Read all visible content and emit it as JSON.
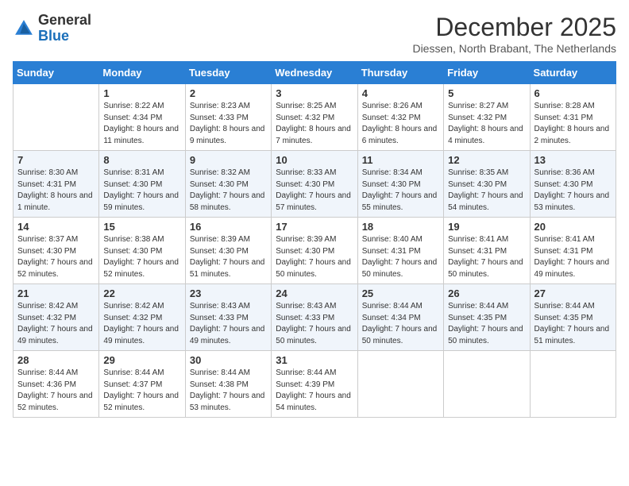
{
  "logo": {
    "general": "General",
    "blue": "Blue"
  },
  "header": {
    "month": "December 2025",
    "location": "Diessen, North Brabant, The Netherlands"
  },
  "weekdays": [
    "Sunday",
    "Monday",
    "Tuesday",
    "Wednesday",
    "Thursday",
    "Friday",
    "Saturday"
  ],
  "weeks": [
    [
      {
        "day": "",
        "sunrise": "",
        "sunset": "",
        "daylight": ""
      },
      {
        "day": "1",
        "sunrise": "Sunrise: 8:22 AM",
        "sunset": "Sunset: 4:34 PM",
        "daylight": "Daylight: 8 hours and 11 minutes."
      },
      {
        "day": "2",
        "sunrise": "Sunrise: 8:23 AM",
        "sunset": "Sunset: 4:33 PM",
        "daylight": "Daylight: 8 hours and 9 minutes."
      },
      {
        "day": "3",
        "sunrise": "Sunrise: 8:25 AM",
        "sunset": "Sunset: 4:32 PM",
        "daylight": "Daylight: 8 hours and 7 minutes."
      },
      {
        "day": "4",
        "sunrise": "Sunrise: 8:26 AM",
        "sunset": "Sunset: 4:32 PM",
        "daylight": "Daylight: 8 hours and 6 minutes."
      },
      {
        "day": "5",
        "sunrise": "Sunrise: 8:27 AM",
        "sunset": "Sunset: 4:32 PM",
        "daylight": "Daylight: 8 hours and 4 minutes."
      },
      {
        "day": "6",
        "sunrise": "Sunrise: 8:28 AM",
        "sunset": "Sunset: 4:31 PM",
        "daylight": "Daylight: 8 hours and 2 minutes."
      }
    ],
    [
      {
        "day": "7",
        "sunrise": "Sunrise: 8:30 AM",
        "sunset": "Sunset: 4:31 PM",
        "daylight": "Daylight: 8 hours and 1 minute."
      },
      {
        "day": "8",
        "sunrise": "Sunrise: 8:31 AM",
        "sunset": "Sunset: 4:30 PM",
        "daylight": "Daylight: 7 hours and 59 minutes."
      },
      {
        "day": "9",
        "sunrise": "Sunrise: 8:32 AM",
        "sunset": "Sunset: 4:30 PM",
        "daylight": "Daylight: 7 hours and 58 minutes."
      },
      {
        "day": "10",
        "sunrise": "Sunrise: 8:33 AM",
        "sunset": "Sunset: 4:30 PM",
        "daylight": "Daylight: 7 hours and 57 minutes."
      },
      {
        "day": "11",
        "sunrise": "Sunrise: 8:34 AM",
        "sunset": "Sunset: 4:30 PM",
        "daylight": "Daylight: 7 hours and 55 minutes."
      },
      {
        "day": "12",
        "sunrise": "Sunrise: 8:35 AM",
        "sunset": "Sunset: 4:30 PM",
        "daylight": "Daylight: 7 hours and 54 minutes."
      },
      {
        "day": "13",
        "sunrise": "Sunrise: 8:36 AM",
        "sunset": "Sunset: 4:30 PM",
        "daylight": "Daylight: 7 hours and 53 minutes."
      }
    ],
    [
      {
        "day": "14",
        "sunrise": "Sunrise: 8:37 AM",
        "sunset": "Sunset: 4:30 PM",
        "daylight": "Daylight: 7 hours and 52 minutes."
      },
      {
        "day": "15",
        "sunrise": "Sunrise: 8:38 AM",
        "sunset": "Sunset: 4:30 PM",
        "daylight": "Daylight: 7 hours and 52 minutes."
      },
      {
        "day": "16",
        "sunrise": "Sunrise: 8:39 AM",
        "sunset": "Sunset: 4:30 PM",
        "daylight": "Daylight: 7 hours and 51 minutes."
      },
      {
        "day": "17",
        "sunrise": "Sunrise: 8:39 AM",
        "sunset": "Sunset: 4:30 PM",
        "daylight": "Daylight: 7 hours and 50 minutes."
      },
      {
        "day": "18",
        "sunrise": "Sunrise: 8:40 AM",
        "sunset": "Sunset: 4:31 PM",
        "daylight": "Daylight: 7 hours and 50 minutes."
      },
      {
        "day": "19",
        "sunrise": "Sunrise: 8:41 AM",
        "sunset": "Sunset: 4:31 PM",
        "daylight": "Daylight: 7 hours and 50 minutes."
      },
      {
        "day": "20",
        "sunrise": "Sunrise: 8:41 AM",
        "sunset": "Sunset: 4:31 PM",
        "daylight": "Daylight: 7 hours and 49 minutes."
      }
    ],
    [
      {
        "day": "21",
        "sunrise": "Sunrise: 8:42 AM",
        "sunset": "Sunset: 4:32 PM",
        "daylight": "Daylight: 7 hours and 49 minutes."
      },
      {
        "day": "22",
        "sunrise": "Sunrise: 8:42 AM",
        "sunset": "Sunset: 4:32 PM",
        "daylight": "Daylight: 7 hours and 49 minutes."
      },
      {
        "day": "23",
        "sunrise": "Sunrise: 8:43 AM",
        "sunset": "Sunset: 4:33 PM",
        "daylight": "Daylight: 7 hours and 49 minutes."
      },
      {
        "day": "24",
        "sunrise": "Sunrise: 8:43 AM",
        "sunset": "Sunset: 4:33 PM",
        "daylight": "Daylight: 7 hours and 50 minutes."
      },
      {
        "day": "25",
        "sunrise": "Sunrise: 8:44 AM",
        "sunset": "Sunset: 4:34 PM",
        "daylight": "Daylight: 7 hours and 50 minutes."
      },
      {
        "day": "26",
        "sunrise": "Sunrise: 8:44 AM",
        "sunset": "Sunset: 4:35 PM",
        "daylight": "Daylight: 7 hours and 50 minutes."
      },
      {
        "day": "27",
        "sunrise": "Sunrise: 8:44 AM",
        "sunset": "Sunset: 4:35 PM",
        "daylight": "Daylight: 7 hours and 51 minutes."
      }
    ],
    [
      {
        "day": "28",
        "sunrise": "Sunrise: 8:44 AM",
        "sunset": "Sunset: 4:36 PM",
        "daylight": "Daylight: 7 hours and 52 minutes."
      },
      {
        "day": "29",
        "sunrise": "Sunrise: 8:44 AM",
        "sunset": "Sunset: 4:37 PM",
        "daylight": "Daylight: 7 hours and 52 minutes."
      },
      {
        "day": "30",
        "sunrise": "Sunrise: 8:44 AM",
        "sunset": "Sunset: 4:38 PM",
        "daylight": "Daylight: 7 hours and 53 minutes."
      },
      {
        "day": "31",
        "sunrise": "Sunrise: 8:44 AM",
        "sunset": "Sunset: 4:39 PM",
        "daylight": "Daylight: 7 hours and 54 minutes."
      },
      {
        "day": "",
        "sunrise": "",
        "sunset": "",
        "daylight": ""
      },
      {
        "day": "",
        "sunrise": "",
        "sunset": "",
        "daylight": ""
      },
      {
        "day": "",
        "sunrise": "",
        "sunset": "",
        "daylight": ""
      }
    ]
  ]
}
